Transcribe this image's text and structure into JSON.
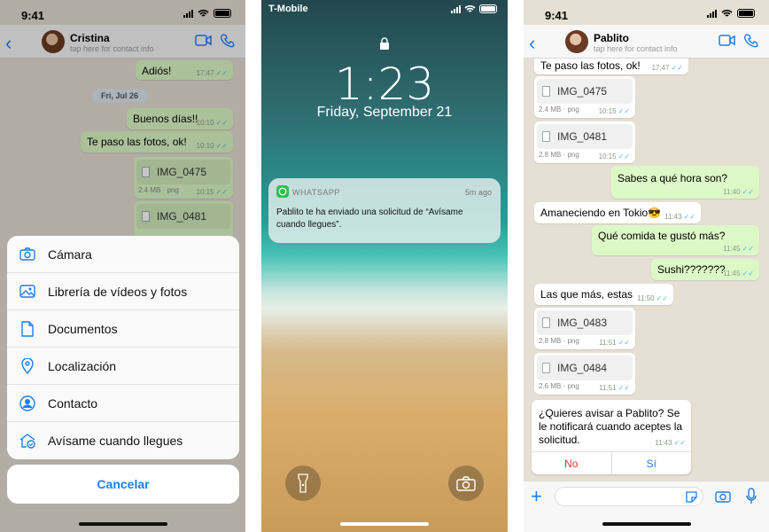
{
  "left": {
    "status_time": "9:41",
    "contact_name": "Cristina",
    "contact_sub": "tap here for contact info",
    "messages": [
      {
        "text": "Adiós!",
        "time": "17:47"
      },
      {
        "text": "Buenos días!!",
        "time": "10:10"
      },
      {
        "text": "Te paso las fotos, ok!",
        "time": "10:10"
      }
    ],
    "day_label": "Fri, Jul 26",
    "files": [
      {
        "name": "IMG_0475",
        "meta": "2.4 MB · png",
        "time": "10:15"
      },
      {
        "name": "IMG_0481",
        "meta": "",
        "time": ""
      }
    ],
    "sheet_options": [
      {
        "label": "Cámara",
        "icon": "camera-icon"
      },
      {
        "label": "Librería de vídeos y fotos",
        "icon": "photo-icon"
      },
      {
        "label": "Documentos",
        "icon": "document-icon"
      },
      {
        "label": "Localización",
        "icon": "location-icon"
      },
      {
        "label": "Contacto",
        "icon": "contact-icon"
      },
      {
        "label": "Avísame cuando llegues",
        "icon": "home-notify-icon"
      }
    ],
    "cancel": "Cancelar"
  },
  "middle": {
    "carrier": "T-Mobile",
    "clock": "1:23",
    "date": "Friday, September 21",
    "notif_app": "WHATSAPP",
    "notif_time": "5m ago",
    "notif_body": "Pablito te ha enviado una solicitud de “Avísame cuando llegues”."
  },
  "right": {
    "status_time": "9:41",
    "contact_name": "Pablito",
    "contact_sub": "tap here for contact info",
    "m1": {
      "text": "Te paso las fotos, ok!",
      "time": "17:47"
    },
    "f1": {
      "name": "IMG_0475",
      "meta": "2.4 MB · png",
      "time": "10:15"
    },
    "f2": {
      "name": "IMG_0481",
      "meta": "2.8 MB · png",
      "time": "10:15"
    },
    "m2": {
      "text": "Sabes a qué hora son?",
      "time": "11:40"
    },
    "m3": {
      "text": "Amaneciendo en Tokio😎",
      "time": "11:43"
    },
    "m4": {
      "text": "Qué comida te gustó más?",
      "time": "11:45"
    },
    "m5": {
      "text": "Sushi???????",
      "time": "11:45"
    },
    "m6": {
      "text": "Las que más, estas",
      "time": "11:50"
    },
    "f3": {
      "name": "IMG_0483",
      "meta": "2.8 MB · png",
      "time": "11:51"
    },
    "f4": {
      "name": "IMG_0484",
      "meta": "2.6 MB · png",
      "time": "11:51"
    },
    "card": {
      "text": "¿Quieres avisar a Pablito? Se le notificará cuando aceptes la solicitud.",
      "time": "11:43",
      "no": "No",
      "yes": "Sí"
    }
  },
  "colors": {
    "accent": "#1a7ff5",
    "outgoing": "#dcf8c6",
    "incoming": "#ffffff",
    "danger": "#e0362c",
    "whatsapp": "#2fbf4f"
  }
}
